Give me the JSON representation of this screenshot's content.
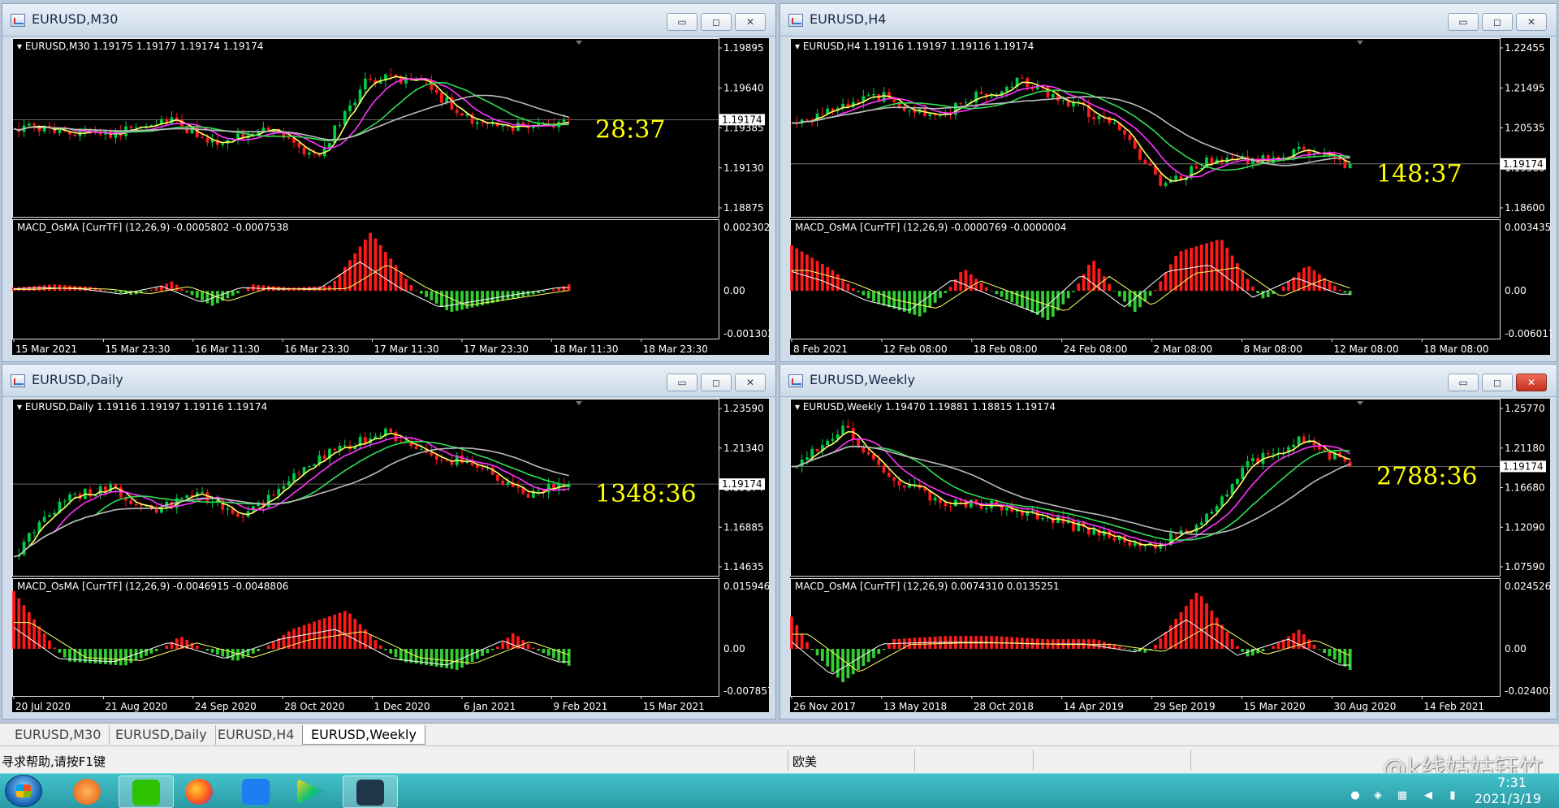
{
  "colors": {
    "price_line": "#e6e6e6",
    "bull_candle": "#00cc44",
    "bear_candle": "#ff1a1a",
    "ma_yellow": "#ffff66",
    "ma_magenta": "#ff33ff",
    "ma_green": "#33dd55",
    "ma_gray": "#bbbbbb",
    "hist_pos": "#ff1a1a",
    "hist_neg": "#33cc33",
    "countdown": "#ffff00",
    "axis_text": "#ffffff",
    "current_price_tag_bg": "#ffffff"
  },
  "window_controls": {
    "minimize": "▭",
    "maximize": "◻",
    "close": "✕"
  },
  "charts": [
    {
      "window_title": "EURUSD,M30",
      "price_info": "EURUSD,M30  1.19175 1.19177 1.19174 1.19174",
      "price_axis": [
        "1.19895",
        "1.19640",
        "1.19385",
        "1.19130",
        "1.18875"
      ],
      "current_price": "1.19174",
      "countdown": "28:37",
      "macd_info": "MACD_OsMA [CurrTF] (12,26,9) -0.0005802 -0.0007538",
      "macd_axis": [
        "0.0023028",
        "0.00",
        "-0.001303"
      ],
      "time_axis": [
        "15 Mar 2021",
        "15 Mar 23:30",
        "16 Mar 11:30",
        "16 Mar 23:30",
        "17 Mar 11:30",
        "17 Mar 23:30",
        "18 Mar 11:30",
        "18 Mar 23:30"
      ],
      "path": [
        0.5,
        0.52,
        0.55,
        0.45,
        0.6,
        0.5,
        0.7,
        0.2,
        0.18,
        0.45,
        0.5,
        0.48
      ],
      "hist": [
        0.05,
        0.1,
        0.06,
        -0.1,
        0.15,
        -0.35,
        0.1,
        0.05,
        0.08,
        0.9,
        0.1,
        -0.5,
        -0.3,
        -0.1,
        0.1
      ]
    },
    {
      "window_title": "EURUSD,H4",
      "price_info": "EURUSD,H4  1.19116 1.19197 1.19116 1.19174",
      "price_axis": [
        "1.22455",
        "1.21495",
        "1.20535",
        "1.19560",
        "1.18600"
      ],
      "current_price": "1.19174",
      "countdown": "148:37",
      "macd_info": "MACD_OsMA [CurrTF] (12,26,9) -0.0000769 -0.0000004",
      "macd_axis": [
        "0.0034358",
        "0.00",
        "-0.0060175"
      ],
      "time_axis": [
        "8 Feb 2021",
        "12 Feb 08:00",
        "18 Feb 08:00",
        "24 Feb 08:00",
        "2 Mar 08:00",
        "8 Mar 08:00",
        "12 Mar 08:00",
        "18 Mar 08:00"
      ],
      "path": [
        0.5,
        0.35,
        0.3,
        0.45,
        0.3,
        0.2,
        0.35,
        0.5,
        0.9,
        0.7,
        0.72,
        0.65,
        0.75
      ],
      "hist": [
        0.7,
        0.3,
        -0.3,
        -0.6,
        0.35,
        -0.2,
        -0.7,
        0.5,
        -0.5,
        0.6,
        0.8,
        -0.2,
        0.4,
        -0.1
      ]
    },
    {
      "window_title": "EURUSD,Daily",
      "price_info": "EURUSD,Daily  1.19116 1.19197 1.19116 1.19174",
      "price_axis": [
        "1.23590",
        "1.21340",
        "1.19174",
        "1.16885",
        "1.14635"
      ],
      "current_price": "1.19174",
      "countdown": "1348:36",
      "macd_info": "MACD_OsMA [CurrTF] (12,26,9) -0.0046915 -0.0048806",
      "macd_axis": [
        "0.0159468",
        "0.00",
        "-0.0078573"
      ],
      "time_axis": [
        "20 Jul 2020",
        "21 Aug 2020",
        "24 Sep 2020",
        "28 Oct 2020",
        "1 Dec 2020",
        "6 Jan 2021",
        "9 Feb 2021",
        "15 Mar 2021"
      ],
      "path": [
        0.95,
        0.6,
        0.5,
        0.65,
        0.55,
        0.7,
        0.45,
        0.25,
        0.15,
        0.3,
        0.35,
        0.55,
        0.48
      ],
      "hist": [
        0.9,
        -0.3,
        -0.4,
        0.2,
        -0.3,
        0.3,
        0.6,
        -0.3,
        -0.5,
        0.25,
        -0.4
      ],
      "current_price_on_axis": true
    },
    {
      "window_title": "EURUSD,Weekly",
      "price_info": "EURUSD,Weekly  1.19470 1.19881 1.18815 1.19174",
      "price_axis": [
        "1.25770",
        "1.21180",
        "1.16680",
        "1.12090",
        "1.07590"
      ],
      "current_price": "1.19174",
      "countdown": "2788:36",
      "macd_info": "MACD_OsMA [CurrTF] (12,26,9) 0.0074310 0.0135251",
      "macd_axis": [
        "0.0245267",
        "0.00",
        "-0.0240031"
      ],
      "time_axis": [
        "26 Nov 2017",
        "13 May 2018",
        "28 Oct 2018",
        "14 Apr 2019",
        "29 Sep 2019",
        "15 Mar 2020",
        "30 Aug 2020",
        "14 Feb 2021"
      ],
      "path": [
        0.4,
        0.1,
        0.45,
        0.6,
        0.62,
        0.7,
        0.8,
        0.9,
        0.75,
        0.35,
        0.2,
        0.35
      ],
      "hist": [
        0.5,
        -0.8,
        0.15,
        0.2,
        0.2,
        0.15,
        0.15,
        -0.1,
        0.9,
        -0.2,
        0.3,
        -0.5
      ]
    }
  ],
  "tabs": [
    "EURUSD,M30",
    "EURUSD,Daily",
    "EURUSD,H4",
    "EURUSD,Weekly"
  ],
  "active_tab": 3,
  "status": {
    "help": "寻求帮助,请按F1键",
    "profile": "欧美",
    "watermark": "@k线姑姑钰竹"
  },
  "taskbar": {
    "time": "7:31",
    "date": "2021/3/19",
    "apps": [
      "wechat-app",
      "firefox-app",
      "feishu-app",
      "video-app",
      "mt4-app"
    ]
  }
}
